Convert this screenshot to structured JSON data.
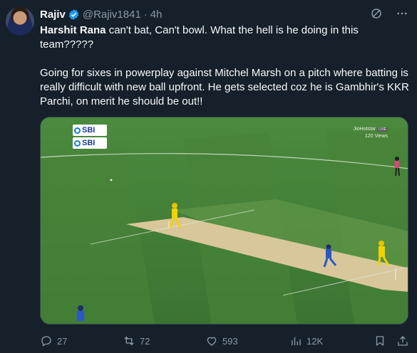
{
  "tweet": {
    "author_name": "Rajiv",
    "handle": "@Rajiv1841",
    "separator": "·",
    "time": "4h",
    "text_bold": "Harshit Rana",
    "text_line1_rest": " can't bat, Can't bowl. What the hell is he doing in this team?????",
    "text_paragraph2": "Going for sixes in powerplay against Mitchel Marsh on a pitch where batting is really difficult with new ball upfront. He gets selected coz he is Gambhir's KKR Parchi, on merit he should be out!!"
  },
  "media": {
    "sponsor_1": "SBI",
    "sponsor_2": "SBI",
    "watermark_title": "JioHotstar",
    "watermark_badge": "LIVE",
    "watermark_views": "120 Views"
  },
  "actions": {
    "replies": "27",
    "reposts": "72",
    "likes": "593",
    "views": "12K"
  },
  "colors": {
    "background": "#15202b",
    "text": "#f7f9f9",
    "muted": "#8b98a5",
    "verified": "#1d9bf0",
    "pitch": "#d8c79a",
    "outfield": "#4c8a3f"
  }
}
